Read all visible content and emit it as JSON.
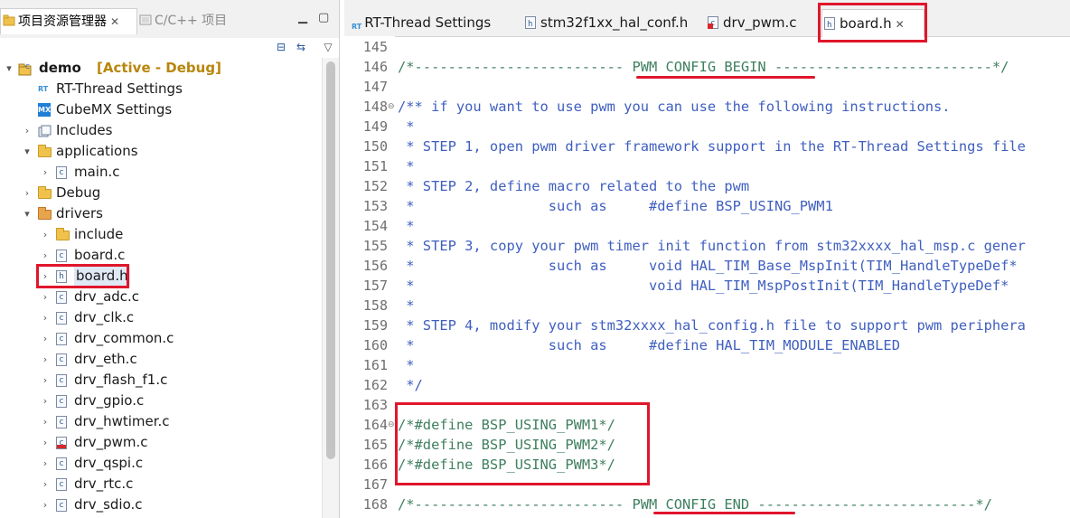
{
  "left_panel": {
    "tabs": [
      {
        "label": "项目资源管理器",
        "active": true
      },
      {
        "label": "C/C++ 项目",
        "active": false
      }
    ],
    "project": {
      "name": "demo",
      "status": "[Active - Debug]"
    },
    "tree": [
      {
        "label": "RT-Thread Settings",
        "icon": "rt-thread-icon",
        "level": 1,
        "arrow": ""
      },
      {
        "label": "CubeMX Settings",
        "icon": "cubemx-icon",
        "level": 1,
        "arrow": ""
      },
      {
        "label": "Includes",
        "icon": "includes-icon",
        "level": 1,
        "arrow": "collapsed"
      },
      {
        "label": "applications",
        "icon": "folder-icon",
        "level": 1,
        "arrow": "expanded"
      },
      {
        "label": "main.c",
        "icon": "c-file-icon",
        "level": 2,
        "arrow": "collapsed"
      },
      {
        "label": "Debug",
        "icon": "folder-icon",
        "level": 1,
        "arrow": "collapsed"
      },
      {
        "label": "drivers",
        "icon": "source-folder-icon",
        "level": 1,
        "arrow": "expanded"
      },
      {
        "label": "include",
        "icon": "folder-icon",
        "level": 2,
        "arrow": "collapsed"
      },
      {
        "label": "board.c",
        "icon": "c-file-icon",
        "level": 2,
        "arrow": "collapsed"
      },
      {
        "label": "board.h",
        "icon": "h-file-icon",
        "level": 2,
        "arrow": "collapsed",
        "selected": true
      },
      {
        "label": "drv_adc.c",
        "icon": "c-file-icon",
        "level": 2,
        "arrow": "collapsed"
      },
      {
        "label": "drv_clk.c",
        "icon": "c-file-icon",
        "level": 2,
        "arrow": "collapsed"
      },
      {
        "label": "drv_common.c",
        "icon": "c-file-icon",
        "level": 2,
        "arrow": "collapsed"
      },
      {
        "label": "drv_eth.c",
        "icon": "c-file-icon",
        "level": 2,
        "arrow": "collapsed"
      },
      {
        "label": "drv_flash_f1.c",
        "icon": "c-file-icon",
        "level": 2,
        "arrow": "collapsed"
      },
      {
        "label": "drv_gpio.c",
        "icon": "c-file-icon",
        "level": 2,
        "arrow": "collapsed"
      },
      {
        "label": "drv_hwtimer.c",
        "icon": "c-file-icon",
        "level": 2,
        "arrow": "collapsed"
      },
      {
        "label": "drv_pwm.c",
        "icon": "c-file-error-icon",
        "level": 2,
        "arrow": "collapsed"
      },
      {
        "label": "drv_qspi.c",
        "icon": "c-file-icon",
        "level": 2,
        "arrow": "collapsed"
      },
      {
        "label": "drv_rtc.c",
        "icon": "c-file-icon",
        "level": 2,
        "arrow": "collapsed"
      },
      {
        "label": "drv_sdio.c",
        "icon": "c-file-icon",
        "level": 2,
        "arrow": "collapsed"
      }
    ]
  },
  "editor": {
    "tabs": [
      {
        "label": "RT-Thread Settings",
        "icon": "rt-thread-icon",
        "active": false
      },
      {
        "label": "stm32f1xx_hal_conf.h",
        "icon": "h-file-icon",
        "active": false
      },
      {
        "label": "drv_pwm.c",
        "icon": "c-file-error-icon",
        "active": false
      },
      {
        "label": "board.h",
        "icon": "h-file-icon",
        "active": true
      }
    ],
    "lines": [
      {
        "num": "145",
        "text": "",
        "style": "green",
        "fold": false
      },
      {
        "num": "146",
        "text": "/*------------------------- PWM CONFIG BEGIN --------------------------*/",
        "style": "green",
        "fold": false
      },
      {
        "num": "147",
        "text": "",
        "style": "green",
        "fold": false
      },
      {
        "num": "148",
        "text": "/** if you want to use pwm you can use the following instructions.",
        "style": "blue",
        "fold": true
      },
      {
        "num": "149",
        "text": " *",
        "style": "blue",
        "fold": false
      },
      {
        "num": "150",
        "text": " * STEP 1, open pwm driver framework support in the RT-Thread Settings file",
        "style": "blue",
        "fold": false
      },
      {
        "num": "151",
        "text": " *",
        "style": "blue",
        "fold": false
      },
      {
        "num": "152",
        "text": " * STEP 2, define macro related to the pwm",
        "style": "blue",
        "fold": false
      },
      {
        "num": "153",
        "text": " *                such as     #define BSP_USING_PWM1",
        "style": "blue",
        "fold": false
      },
      {
        "num": "154",
        "text": " *",
        "style": "blue",
        "fold": false
      },
      {
        "num": "155",
        "text": " * STEP 3, copy your pwm timer init function from stm32xxxx_hal_msp.c gener",
        "style": "blue",
        "fold": false
      },
      {
        "num": "156",
        "text": " *                such as     void HAL_TIM_Base_MspInit(TIM_HandleTypeDef*",
        "style": "blue",
        "fold": false
      },
      {
        "num": "157",
        "text": " *                            void HAL_TIM_MspPostInit(TIM_HandleTypeDef*",
        "style": "blue",
        "fold": false
      },
      {
        "num": "158",
        "text": " *",
        "style": "blue",
        "fold": false
      },
      {
        "num": "159",
        "text": " * STEP 4, modify your stm32xxxx_hal_config.h file to support pwm periphera",
        "style": "blue",
        "fold": false
      },
      {
        "num": "160",
        "text": " *                such as     #define HAL_TIM_MODULE_ENABLED",
        "style": "blue",
        "fold": false
      },
      {
        "num": "161",
        "text": " *",
        "style": "blue",
        "fold": false
      },
      {
        "num": "162",
        "text": " */",
        "style": "blue",
        "fold": false
      },
      {
        "num": "163",
        "text": "",
        "style": "green",
        "fold": false
      },
      {
        "num": "164",
        "text": "/*#define BSP_USING_PWM1*/",
        "style": "green",
        "fold": true
      },
      {
        "num": "165",
        "text": "/*#define BSP_USING_PWM2*/",
        "style": "green",
        "fold": false
      },
      {
        "num": "166",
        "text": "/*#define BSP_USING_PWM3*/",
        "style": "green",
        "fold": false
      },
      {
        "num": "167",
        "text": "",
        "style": "green",
        "fold": false
      },
      {
        "num": "168",
        "text": "/*------------------------- PWM CONFIG END --------------------------*/",
        "style": "green",
        "fold": false
      }
    ]
  },
  "colors": {
    "highlight_red": "#e0162b",
    "comment_green": "#3f7f5f",
    "javadoc_blue": "#3f5fbf",
    "active_status": "#b8860b"
  }
}
